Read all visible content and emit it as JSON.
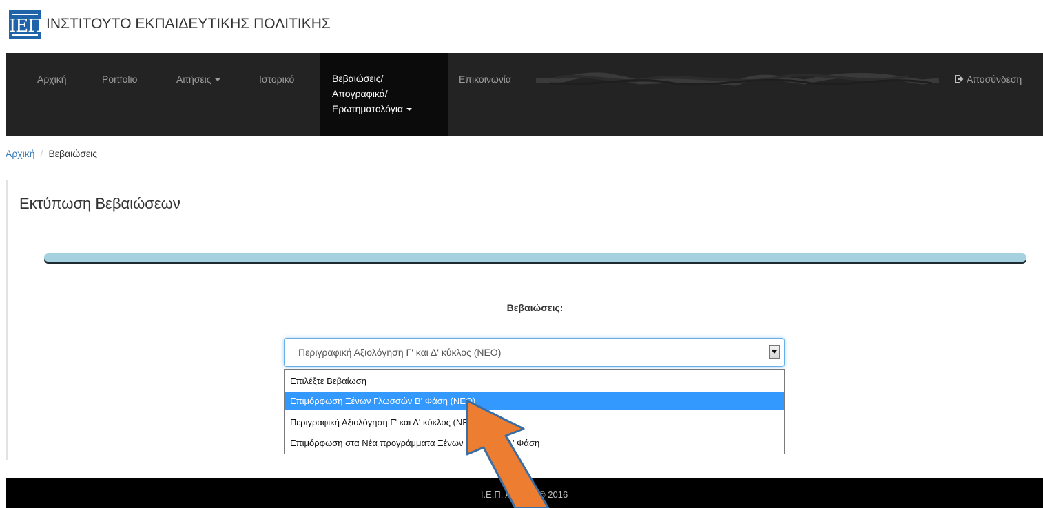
{
  "header": {
    "logo_text": "ΙΕΠ",
    "brand_name": "ΙΝΣΤΙΤΟΥΤΟ ΕΚΠΑΙΔΕΥΤΙΚΗΣ ΠΟΛΙΤΙΚΗΣ"
  },
  "navbar": {
    "items": [
      {
        "label": "Αρχική"
      },
      {
        "label": "Portfolio"
      },
      {
        "label": "Αιτήσεις"
      },
      {
        "label": "Ιστορικό"
      }
    ],
    "active": {
      "line1": "Βεβαιώσεις/",
      "line2": "Απογραφικά/",
      "line3": "Ερωτηματολόγια"
    },
    "contact": "Επικοινωνία",
    "logout": "Αποσύνδεση"
  },
  "breadcrumb": {
    "home": "Αρχική",
    "separator": "/",
    "current": "Βεβαιώσεις"
  },
  "main": {
    "title": "Εκτύπωση Βεβαιώσεων",
    "select_label": "Βεβαιώσεις:",
    "select_value": "Περιγραφική Αξιολόγηση Γ' και Δ' κύκλος (ΝΕΟ)",
    "options": [
      "Επιλέξτε Βεβαίωση",
      "Επιμόρφωση Ξένων Γλωσσών Β' Φάση (ΝΕΟ)",
      "Περιγραφική Αξιολόγηση Γ' και Δ' κύκλος (ΝΕΟ)",
      "Επιμόρφωση στα Νέα προγράμματα Ξένων Γλωσσών Α' Φάση"
    ],
    "highlighted_option_index": 1
  },
  "footer": {
    "text": "Ι.Ε.Π. ΑΘΗΝΑ © 2016"
  },
  "colors": {
    "navbar_bg": "#232323",
    "nav_active_bg": "#0b0b0b",
    "accent_bar": "#a6d2e0",
    "selected_option": "#3399ff",
    "annotation_arrow": "#ed7d31",
    "logo_bg": "#1f63a8"
  }
}
